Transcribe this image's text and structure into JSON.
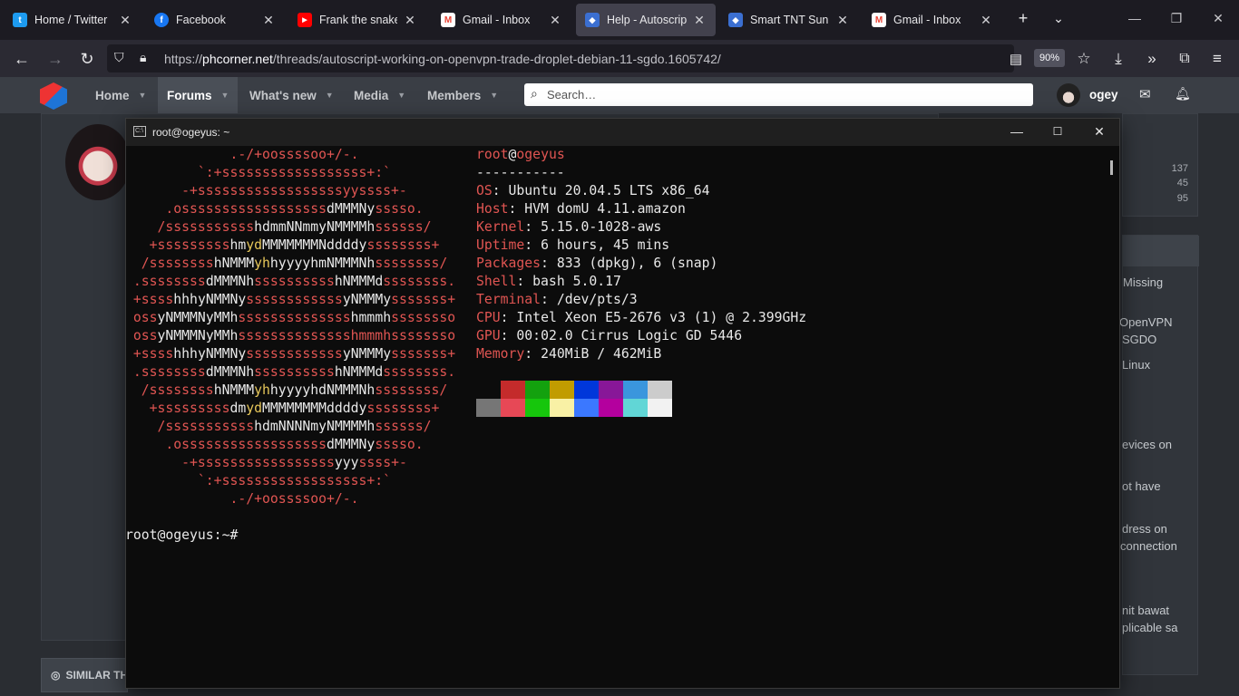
{
  "browser": {
    "tabs": [
      {
        "title": "Home / Twitter",
        "icon": "twitter-icon",
        "color": "#1d9bf0",
        "glyph": "t"
      },
      {
        "title": "Facebook",
        "icon": "facebook-icon",
        "color": "#1877f2",
        "glyph": "f"
      },
      {
        "title": "Frank the snake get",
        "icon": "youtube-icon",
        "color": "#ff0000",
        "glyph": "▶"
      },
      {
        "title": "Gmail - Inbox",
        "icon": "gmail-icon",
        "color": "#ea4335",
        "glyph": "M"
      },
      {
        "title": "Help - Autoscript W",
        "icon": "phcorner-icon",
        "color": "#3b6fd1",
        "glyph": "◆"
      },
      {
        "title": "Smart TNT Sun - Cl",
        "icon": "phcorner-icon",
        "color": "#3b6fd1",
        "glyph": "◆"
      },
      {
        "title": "Gmail - Inbox",
        "icon": "gmail-icon",
        "color": "#ea4335",
        "glyph": "M"
      }
    ],
    "url_domain": "phcorner.net",
    "url_prefix": "https://",
    "url_path": "/threads/autoscript-working-on-openvpn-trade-droplet-debian-11-sgdo.1605742/",
    "zoom": "90%"
  },
  "site": {
    "nav": [
      {
        "label": "Home"
      },
      {
        "label": "Forums"
      },
      {
        "label": "What's new"
      },
      {
        "label": "Media"
      },
      {
        "label": "Members"
      }
    ],
    "search_placeholder": "Search…",
    "username": "ogey"
  },
  "sidebar": {
    "stats": [
      "137",
      "45",
      "95"
    ],
    "snippets": [
      "Missing",
      "OpenVPN",
      "SGDO",
      "Linux",
      "evices on",
      "ot have",
      "dress on",
      "connection",
      "nit bawat",
      "plicable sa"
    ]
  },
  "similar_label": "SIMILAR TH",
  "terminal": {
    "title": "root@ogeyus: ~",
    "user": "root",
    "host": "ogeyus",
    "separator": "-----------",
    "info": [
      {
        "key": "OS",
        "value": "Ubuntu 20.04.5 LTS x86_64"
      },
      {
        "key": "Host",
        "value": "HVM domU 4.11.amazon"
      },
      {
        "key": "Kernel",
        "value": "5.15.0-1028-aws"
      },
      {
        "key": "Uptime",
        "value": "6 hours, 45 mins"
      },
      {
        "key": "Packages",
        "value": "833 (dpkg), 6 (snap)"
      },
      {
        "key": "Shell",
        "value": "bash 5.0.17"
      },
      {
        "key": "Terminal",
        "value": "/dev/pts/3"
      },
      {
        "key": "CPU",
        "value": "Intel Xeon E5-2676 v3 (1) @ 2.399GHz"
      },
      {
        "key": "GPU",
        "value": "00:02.0 Cirrus Logic GD 5446"
      },
      {
        "key": "Memory",
        "value": "240MiB / 462MiB"
      }
    ],
    "prompt": "root@ogeyus:~#",
    "palette_top": [
      "#0c0c0c",
      "#c42b2b",
      "#13a10e",
      "#c19c00",
      "#0037da",
      "#881798",
      "#3a96dd",
      "#cccccc"
    ],
    "palette_bottom": [
      "#767676",
      "#e74856",
      "#16c60c",
      "#f9f1a5",
      "#3b78ff",
      "#b4009e",
      "#61d6d6",
      "#f2f2f2"
    ]
  }
}
